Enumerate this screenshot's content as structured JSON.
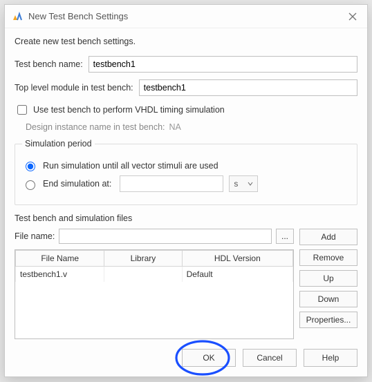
{
  "window": {
    "title": "New Test Bench Settings"
  },
  "desc": "Create new test bench settings.",
  "fields": {
    "name_label": "Test bench name:",
    "name_value": "testbench1",
    "top_label": "Top level module in test bench:",
    "top_value": "testbench1",
    "vhdl_checkbox": "Use test bench to perform VHDL timing simulation",
    "design_inst_label": "Design instance name in test bench:",
    "design_inst_value": "NA"
  },
  "sim": {
    "legend": "Simulation period",
    "run_until": "Run simulation until all vector stimuli are used",
    "end_at": "End simulation at:",
    "end_value": "",
    "unit": "s"
  },
  "files": {
    "section": "Test bench and simulation files",
    "filename_label": "File name:",
    "filename_value": "",
    "browse": "...",
    "columns": {
      "c0": "File Name",
      "c1": "Library",
      "c2": "HDL Version"
    },
    "rows": [
      {
        "name": "testbench1.v",
        "lib": "",
        "ver": "Default"
      }
    ],
    "buttons": {
      "add": "Add",
      "remove": "Remove",
      "up": "Up",
      "down": "Down",
      "props": "Properties..."
    }
  },
  "footer": {
    "ok": "OK",
    "cancel": "Cancel",
    "help": "Help"
  }
}
